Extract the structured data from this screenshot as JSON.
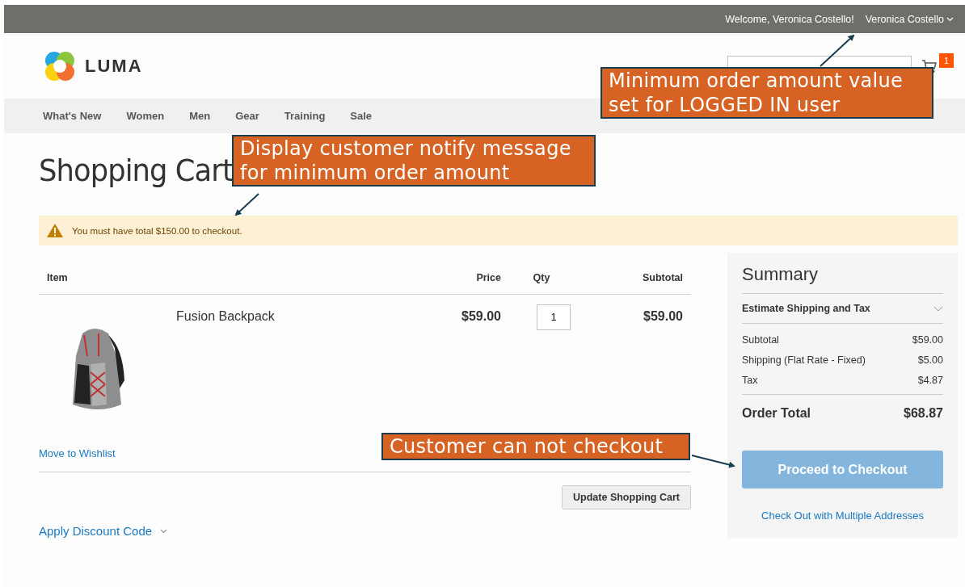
{
  "top_bar": {
    "welcome": "Welcome, Veronica Costello!",
    "account_name": "Veronica Costello"
  },
  "header": {
    "logo_text": "LUMA",
    "cart_count": "1"
  },
  "nav": {
    "items": [
      "What's New",
      "Women",
      "Men",
      "Gear",
      "Training",
      "Sale"
    ]
  },
  "page_title": "Shopping Cart",
  "notice": {
    "message": "You must have total $150.00 to checkout."
  },
  "cart": {
    "columns": [
      "Item",
      "Price",
      "Qty",
      "Subtotal"
    ],
    "items": [
      {
        "name": "Fusion Backpack",
        "price": "$59.00",
        "qty": "1",
        "subtotal": "$59.00"
      }
    ],
    "move_to_wishlist": "Move to Wishlist",
    "update_button": "Update Shopping Cart",
    "discount_link": "Apply Discount Code"
  },
  "summary": {
    "title": "Summary",
    "estimate_label": "Estimate Shipping and Tax",
    "expanded": false,
    "rows": [
      {
        "label": "Subtotal",
        "value": "$59.00"
      },
      {
        "label": "Shipping (Flat Rate - Fixed)",
        "value": "$5.00"
      },
      {
        "label": "Tax",
        "value": "$4.87"
      }
    ],
    "total": {
      "label": "Order Total",
      "value": "$68.87"
    },
    "checkout_button": {
      "label": "Proceed to Checkout",
      "disabled": true
    },
    "multi_address_link": "Check Out with Multiple Addresses"
  },
  "annotations": [
    {
      "text": "Minimum order amount value\nset for LOGGED IN user"
    },
    {
      "text": "Display customer notify message\nfor minimum order amount"
    },
    {
      "text": "Customer can not checkout"
    }
  ]
}
